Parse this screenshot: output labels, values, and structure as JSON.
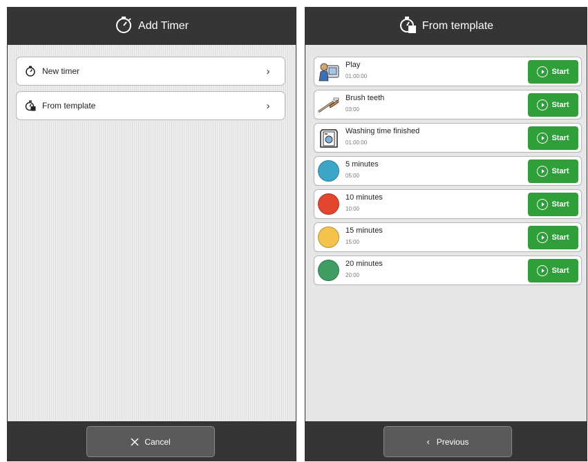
{
  "add_timer": {
    "title": "Add Timer",
    "title_icon": "stopwatch-icon",
    "menu": [
      {
        "label": "New timer",
        "icon": "stopwatch-icon"
      },
      {
        "label": "From template",
        "icon": "template-stopwatch-icon"
      }
    ],
    "cancel_label": "Cancel",
    "cancel_icon": "close-icon"
  },
  "from_template": {
    "title": "From template",
    "title_icon": "template-stopwatch-icon",
    "start_label": "Start",
    "templates": [
      {
        "name": "Play",
        "duration": "01:00:00",
        "icon": "play-pictogram-icon",
        "color": null
      },
      {
        "name": "Brush teeth",
        "duration": "03:00",
        "icon": "toothbrush-icon",
        "color": null
      },
      {
        "name": "Washing time finished",
        "duration": "01:00:00",
        "icon": "washing-machine-icon",
        "color": null
      },
      {
        "name": "5 minutes",
        "duration": "05:00",
        "icon": "circle-icon",
        "color": "#3ba6c8"
      },
      {
        "name": "10 minutes",
        "duration": "10:00",
        "icon": "circle-icon",
        "color": "#e2462f"
      },
      {
        "name": "15 minutes",
        "duration": "15:00",
        "icon": "circle-icon",
        "color": "#f5c24c"
      },
      {
        "name": "20 minutes",
        "duration": "20:00",
        "icon": "circle-icon",
        "color": "#3f9d62"
      }
    ],
    "previous_label": "Previous",
    "previous_icon": "chevron-left-icon"
  },
  "colors": {
    "header": "#353535",
    "accent_green": "#2f9e3b",
    "footer_button": "#5a5a5a"
  }
}
